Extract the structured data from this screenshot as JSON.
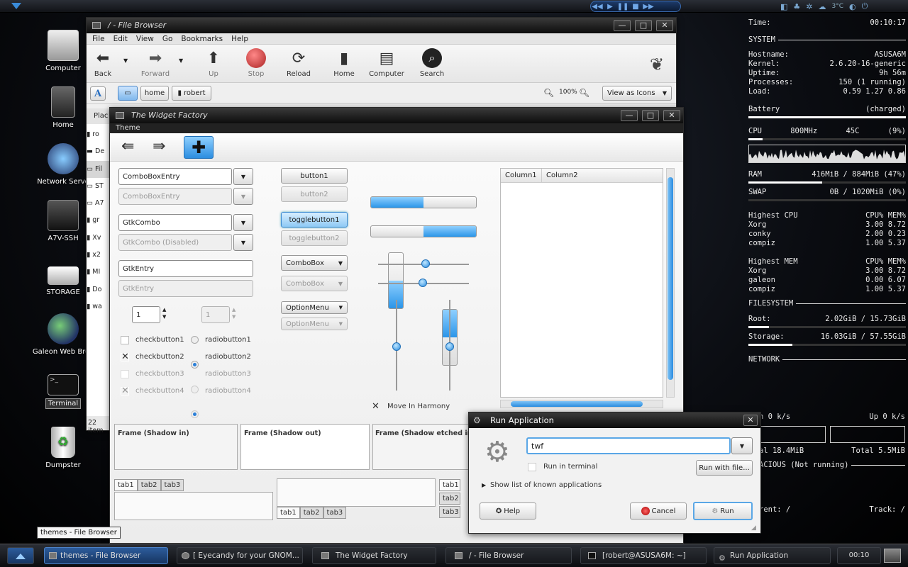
{
  "topbar": {
    "media": [
      "◀◀",
      "▶",
      "❚❚",
      "■",
      "▶▶"
    ],
    "temp": "3°C"
  },
  "desktop": {
    "icons": [
      {
        "name": "computer-icon",
        "label": "Computer"
      },
      {
        "name": "home-icon",
        "label": "Home"
      },
      {
        "name": "network-icon",
        "label": "Network Serve"
      },
      {
        "name": "ssh-icon",
        "label": "A7V-SSH"
      },
      {
        "name": "storage-icon",
        "label": "STORAGE"
      },
      {
        "name": "galeon-icon",
        "label": "Galeon Web Brov"
      },
      {
        "name": "terminal-icon",
        "label": "Terminal"
      },
      {
        "name": "trash-icon",
        "label": "Dumpster"
      }
    ]
  },
  "conky": {
    "time_label": "Time:",
    "time": "00:10:17",
    "system": "SYSTEM",
    "hostname_label": "Hostname:",
    "hostname": "ASUSA6M",
    "kernel_label": "Kernel:",
    "kernel": "2.6.20-16-generic",
    "uptime_label": "Uptime:",
    "uptime": "9h 56m",
    "processes_label": "Processes:",
    "processes": "150 (1 running)",
    "load_label": "Load:",
    "load": "0.59 1.27 0.86",
    "battery_label": "Battery",
    "battery": "(charged)",
    "battery_fill": 100,
    "cpu_label": "CPU",
    "cpu_freq": "800MHz",
    "cpu_temp": "45C",
    "cpu_pct": "(9%)",
    "cpu_fill": 9,
    "ram_label": "RAM",
    "ram": "416MiB / 884MiB (47%)",
    "ram_fill": 47,
    "swap_label": "SWAP",
    "swap": "0B / 1020MiB (0%)",
    "swap_fill": 0,
    "hcpu_label": "Highest CPU",
    "hcpu_cols": "CPU% MEM%",
    "hcpu": [
      [
        "Xorg",
        "3.00",
        "8.72"
      ],
      [
        "conky",
        "2.00",
        "0.23"
      ],
      [
        "compiz",
        "1.00",
        "5.37"
      ]
    ],
    "hmem_label": "Highest MEM",
    "hmem_cols": "CPU% MEM%",
    "hmem": [
      [
        "Xorg",
        "3.00",
        "8.72"
      ],
      [
        "galeon",
        "0.00",
        "6.07"
      ],
      [
        "compiz",
        "1.00",
        "5.37"
      ]
    ],
    "fs": "FILESYSTEM",
    "root_label": "Root:",
    "root": "2.02GiB / 15.73GiB",
    "root_fill": 13,
    "storage_label": "Storage:",
    "storage": "16.03GiB / 57.55GiB",
    "storage_fill": 28,
    "network": "NETWORK",
    "down": "n 0 k/s",
    "up": "Up 0 k/s",
    "total_down": "al 18.4MiB",
    "total_up": "Total 5.5MiB",
    "audacious": "ACIOUS (Not running)",
    "current": "rent: /",
    "track": "Track: /"
  },
  "filebrowser": {
    "title": "/ - File Browser",
    "menu": [
      "File",
      "Edit",
      "View",
      "Go",
      "Bookmarks",
      "Help"
    ],
    "toolbar": {
      "back": "Back",
      "forward": "Forward",
      "up": "Up",
      "stop": "Stop",
      "reload": "Reload",
      "home": "Home",
      "computer": "Computer",
      "search": "Search"
    },
    "path": [
      "home",
      "robert"
    ],
    "zoom": "100%",
    "view": "View as Icons",
    "places": "Plac",
    "side": [
      "ro",
      "De",
      "Fil",
      "ST",
      "A7",
      "gr",
      "Xv",
      "x2",
      "MI",
      "Do",
      "wa"
    ],
    "status": "22 item"
  },
  "widgetfactory": {
    "title": "The Widget Factory",
    "menu": "Theme",
    "combo1": "ComboBoxEntry",
    "combo2": "ComboBoxEntry",
    "gcombo1": "GtkCombo",
    "gcombo2": "GtkCombo (Disabled)",
    "entry1": "GtkEntry",
    "entry2": "GtkEntry",
    "spin1": "1",
    "spin2": "1",
    "check1": "checkbutton1",
    "check2": "checkbutton2",
    "check3": "checkbutton3",
    "check4": "checkbutton4",
    "radio1": "radiobutton1",
    "radio2": "radiobutton2",
    "radio3": "radiobutton3",
    "radio4": "radiobutton4",
    "button1": "button1",
    "button2": "button2",
    "toggle1": "togglebutton1",
    "toggle2": "togglebutton2",
    "cbox1": "ComboBox",
    "cbox2": "ComboBox",
    "opt1": "OptionMenu",
    "opt2": "OptionMenu",
    "harmony": "Move In Harmony",
    "col1": "Column1",
    "col2": "Column2",
    "frame1": "Frame (Shadow in)",
    "frame2": "Frame (Shadow out)",
    "frame3": "Frame (Shadow etched in)",
    "tabs": [
      "tab1",
      "tab2",
      "tab3"
    ],
    "progress_h1": 0.5,
    "progress_h2": 0.5,
    "progress_v1": 0.5,
    "progress_v2": 0.5
  },
  "run": {
    "title": "Run Application",
    "command": "twf",
    "terminal": "Run in terminal",
    "runwith": "Run with file...",
    "known": "Show list of known applications",
    "help": "Help",
    "cancel": "Cancel",
    "run": "Run"
  },
  "tooltip": "themes - File Browser",
  "taskbar": {
    "tasks": [
      "themes - File Browser",
      "[ Eyecandy for your GNOM...",
      "The Widget Factory",
      "/ - File Browser",
      "[robert@ASUSA6M: ~]",
      "Run Application"
    ],
    "clock": "00:10"
  }
}
